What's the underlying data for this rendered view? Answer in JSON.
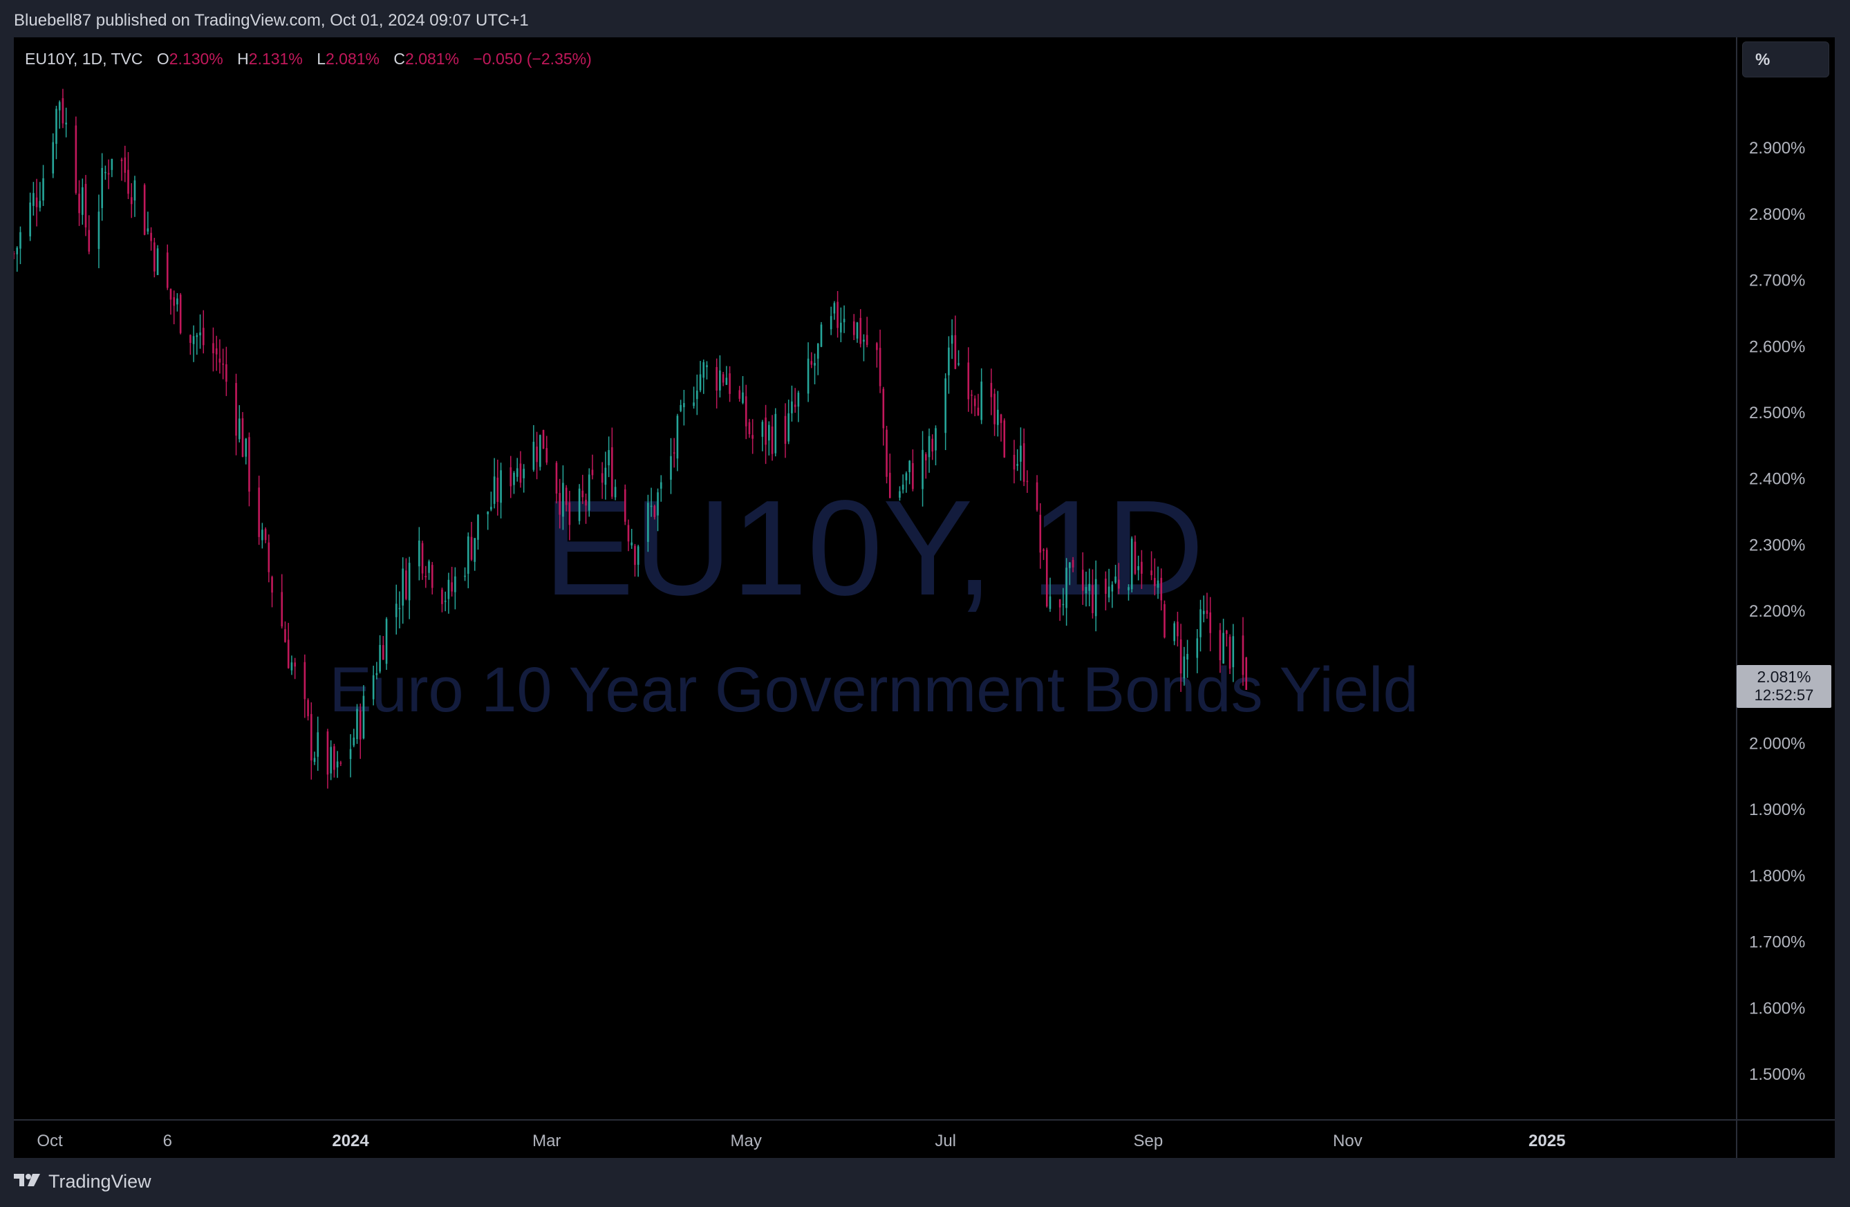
{
  "header": {
    "publisher_text": "Bluebell87 published on TradingView.com, Oct 01, 2024 09:07 UTC+1"
  },
  "legend": {
    "symbol": "EU10Y, 1D, TVC",
    "open_label": "O",
    "open_value": "2.130%",
    "high_label": "H",
    "high_value": "2.131%",
    "low_label": "L",
    "low_value": "2.081%",
    "close_label": "C",
    "close_value": "2.081%",
    "change": "−0.050 (−2.35%)"
  },
  "scale_button": {
    "label": "%"
  },
  "price_badge": {
    "price": "2.081%",
    "countdown": "12:52:57"
  },
  "watermark": {
    "line1": "EU10Y, 1D",
    "line2": "Euro 10 Year Government Bonds Yield"
  },
  "footer": {
    "brand": "TradingView"
  },
  "colors": {
    "up": "#26a69a",
    "down": "#c2185b",
    "background": "#000000",
    "panel": "#1e222d",
    "axis_text": "#b2b5be",
    "watermark": "#131c3d"
  },
  "chart_data": {
    "type": "candlestick",
    "symbol": "EU10Y",
    "timeframe": "1D",
    "y_axis": {
      "ylim": [
        1.4,
        3.0
      ],
      "ticks": [
        2.9,
        2.8,
        2.7,
        2.6,
        2.5,
        2.4,
        2.3,
        2.2,
        2.1,
        2.0,
        1.9,
        1.8,
        1.7,
        1.6,
        1.5
      ],
      "tick_labels": [
        "2.900%",
        "2.800%",
        "2.700%",
        "2.600%",
        "2.500%",
        "2.400%",
        "2.300%",
        "2.200%",
        "2.100%",
        "2.000%",
        "1.900%",
        "1.800%",
        "1.700%",
        "1.600%",
        "1.500%"
      ]
    },
    "x_axis": {
      "range": [
        "2023-09-20",
        "2025-02-28"
      ],
      "ticks": [
        {
          "label": "Oct",
          "date": "2023-10-01",
          "bold": false
        },
        {
          "label": "6",
          "date": "2023-11-06",
          "bold": false
        },
        {
          "label": "2024",
          "date": "2024-01-01",
          "bold": true
        },
        {
          "label": "Mar",
          "date": "2024-03-01",
          "bold": false
        },
        {
          "label": "May",
          "date": "2024-05-01",
          "bold": false
        },
        {
          "label": "Jul",
          "date": "2024-07-01",
          "bold": false
        },
        {
          "label": "Sep",
          "date": "2024-09-01",
          "bold": false
        },
        {
          "label": "Nov",
          "date": "2024-11-01",
          "bold": false
        },
        {
          "label": "2025",
          "date": "2025-01-01",
          "bold": true
        }
      ]
    },
    "close_path": [
      [
        "2023-09-20",
        2.74
      ],
      [
        "2023-09-29",
        2.86
      ],
      [
        "2023-10-04",
        2.98
      ],
      [
        "2023-10-13",
        2.76
      ],
      [
        "2023-10-20",
        2.9
      ],
      [
        "2023-10-27",
        2.84
      ],
      [
        "2023-11-06",
        2.68
      ],
      [
        "2023-11-14",
        2.62
      ],
      [
        "2023-11-22",
        2.58
      ],
      [
        "2023-11-28",
        2.48
      ],
      [
        "2023-12-05",
        2.3
      ],
      [
        "2023-12-11",
        2.18
      ],
      [
        "2023-12-20",
        2.0
      ],
      [
        "2023-12-28",
        1.95
      ],
      [
        "2024-01-05",
        2.05
      ],
      [
        "2024-01-12",
        2.18
      ],
      [
        "2024-01-22",
        2.3
      ],
      [
        "2024-01-31",
        2.22
      ],
      [
        "2024-02-09",
        2.33
      ],
      [
        "2024-02-20",
        2.42
      ],
      [
        "2024-02-29",
        2.46
      ],
      [
        "2024-03-08",
        2.33
      ],
      [
        "2024-03-20",
        2.42
      ],
      [
        "2024-03-28",
        2.3
      ],
      [
        "2024-04-05",
        2.38
      ],
      [
        "2024-04-16",
        2.56
      ],
      [
        "2024-04-25",
        2.56
      ],
      [
        "2024-05-03",
        2.46
      ],
      [
        "2024-05-14",
        2.48
      ],
      [
        "2024-05-24",
        2.6
      ],
      [
        "2024-05-31",
        2.66
      ],
      [
        "2024-06-10",
        2.58
      ],
      [
        "2024-06-14",
        2.37
      ],
      [
        "2024-06-21",
        2.41
      ],
      [
        "2024-06-28",
        2.45
      ],
      [
        "2024-07-02",
        2.6
      ],
      [
        "2024-07-10",
        2.54
      ],
      [
        "2024-07-19",
        2.45
      ],
      [
        "2024-07-26",
        2.42
      ],
      [
        "2024-08-02",
        2.2
      ],
      [
        "2024-08-08",
        2.24
      ],
      [
        "2024-08-16",
        2.22
      ],
      [
        "2024-08-23",
        2.25
      ],
      [
        "2024-08-29",
        2.29
      ],
      [
        "2024-09-06",
        2.19
      ],
      [
        "2024-09-12",
        2.12
      ],
      [
        "2024-09-18",
        2.18
      ],
      [
        "2024-09-26",
        2.14
      ],
      [
        "2024-10-01",
        2.081
      ]
    ],
    "last": {
      "date": "2024-10-01",
      "open": 2.13,
      "high": 2.131,
      "low": 2.081,
      "close": 2.081
    }
  }
}
